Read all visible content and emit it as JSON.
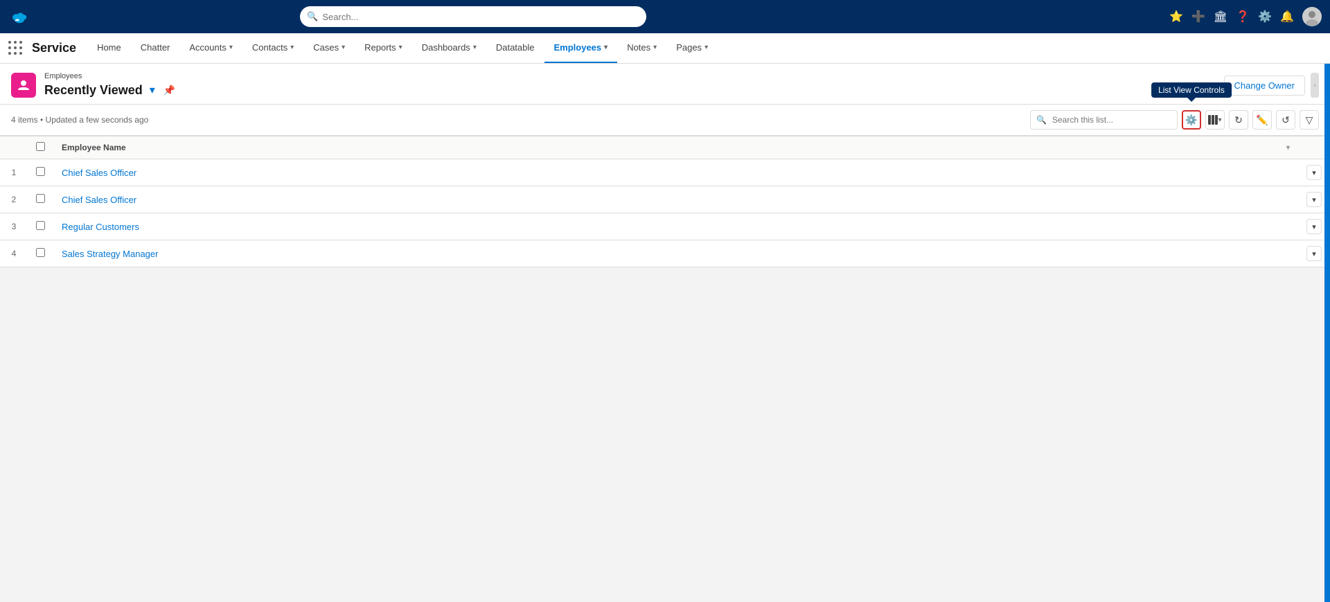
{
  "app": {
    "name": "Service",
    "search_placeholder": "Search..."
  },
  "nav": {
    "items": [
      {
        "label": "Home",
        "has_dropdown": false,
        "active": false
      },
      {
        "label": "Chatter",
        "has_dropdown": false,
        "active": false
      },
      {
        "label": "Accounts",
        "has_dropdown": true,
        "active": false
      },
      {
        "label": "Contacts",
        "has_dropdown": true,
        "active": false
      },
      {
        "label": "Cases",
        "has_dropdown": true,
        "active": false
      },
      {
        "label": "Reports",
        "has_dropdown": true,
        "active": false
      },
      {
        "label": "Dashboards",
        "has_dropdown": true,
        "active": false
      },
      {
        "label": "Datatable",
        "has_dropdown": false,
        "active": false
      },
      {
        "label": "Employees",
        "has_dropdown": true,
        "active": true
      },
      {
        "label": "Notes",
        "has_dropdown": true,
        "active": false
      },
      {
        "label": "Pages",
        "has_dropdown": true,
        "active": false
      }
    ]
  },
  "list": {
    "breadcrumb": "Employees",
    "view_title": "Recently Viewed",
    "status": "4 items • Updated a few seconds ago",
    "search_placeholder": "Search this list...",
    "tooltip_text": "List View Controls",
    "change_owner_label": "Change Owner",
    "columns": [
      {
        "label": "Employee Name"
      }
    ],
    "rows": [
      {
        "num": 1,
        "name": "Chief Sales Officer"
      },
      {
        "num": 2,
        "name": "Chief Sales Officer"
      },
      {
        "num": 3,
        "name": "Regular Customers"
      },
      {
        "num": 4,
        "name": "Sales Strategy Manager"
      }
    ]
  }
}
